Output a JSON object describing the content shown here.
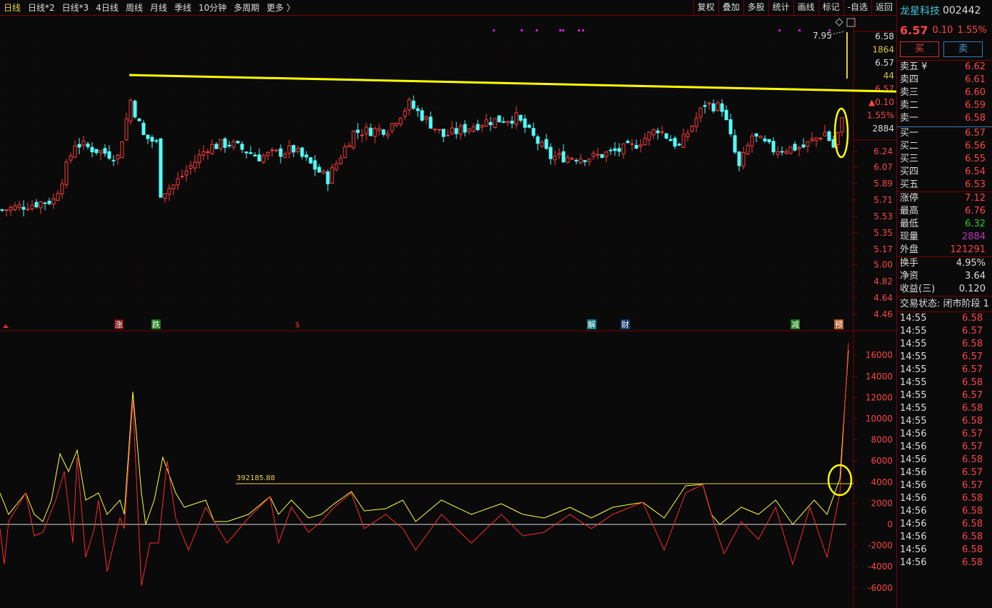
{
  "toolbar": {
    "periods": [
      "日线",
      "日线*2",
      "日线*3",
      "4日线",
      "周线",
      "月线",
      "季线",
      "10分钟",
      "多周期",
      "更多 〉"
    ],
    "tools": [
      "复权",
      "叠加",
      "多股",
      "统计",
      "画线",
      "标记",
      "-自选",
      "返回"
    ]
  },
  "stock": {
    "name": "龙星科技",
    "code": "002442",
    "price": "6.57",
    "change": "0.10",
    "change_pct": "1.55%",
    "buy_label": "买",
    "sell_label": "卖"
  },
  "order_book": {
    "asks": [
      {
        "label": "卖五 ¥",
        "price": "6.62"
      },
      {
        "label": "卖四",
        "price": "6.61"
      },
      {
        "label": "卖三",
        "price": "6.60"
      },
      {
        "label": "卖二",
        "price": "6.59"
      },
      {
        "label": "卖一",
        "price": "6.58"
      }
    ],
    "bids": [
      {
        "label": "买一",
        "price": "6.57"
      },
      {
        "label": "买二",
        "price": "6.56"
      },
      {
        "label": "买三",
        "price": "6.55"
      },
      {
        "label": "买四",
        "price": "6.54"
      },
      {
        "label": "买五",
        "price": "6.53"
      }
    ]
  },
  "stats": [
    {
      "label": "涨停",
      "value": "7.12",
      "color": "red"
    },
    {
      "label": "最高",
      "value": "6.76",
      "color": "red"
    },
    {
      "label": "最低",
      "value": "6.32",
      "color": "green"
    },
    {
      "label": "现量",
      "value": "2884",
      "color": "purple"
    },
    {
      "label": "外盘",
      "value": "121291",
      "color": "red"
    }
  ],
  "stats2": [
    {
      "label": "换手",
      "value": "4.95%"
    },
    {
      "label": "净资",
      "value": "3.64"
    },
    {
      "label": "收益(三)",
      "value": "0.120"
    }
  ],
  "trade_status": "交易状态: 闭市阶段 1",
  "trades": [
    [
      "14:55",
      "6.58"
    ],
    [
      "14:55",
      "6.57"
    ],
    [
      "14:55",
      "6.58"
    ],
    [
      "14:55",
      "6.57"
    ],
    [
      "14:55",
      "6.57"
    ],
    [
      "14:55",
      "6.58"
    ],
    [
      "14:55",
      "6.57"
    ],
    [
      "14:55",
      "6.58"
    ],
    [
      "14:55",
      "6.58"
    ],
    [
      "14:56",
      "6.57"
    ],
    [
      "14:56",
      "6.57"
    ],
    [
      "14:56",
      "6.58"
    ],
    [
      "14:56",
      "6.57"
    ],
    [
      "14:56",
      "6.57"
    ],
    [
      "14:56",
      "6.58"
    ],
    [
      "14:56",
      "6.58"
    ],
    [
      "14:56",
      "6.58"
    ],
    [
      "14:56",
      "6.58"
    ],
    [
      "14:56",
      "6.58"
    ],
    [
      "14:56",
      "6.58"
    ]
  ],
  "price_axis": {
    "floating": [
      {
        "t": "6.58",
        "c": "#ddd"
      },
      {
        "t": "1864",
        "c": "#d8c840"
      },
      {
        "t": "6.57",
        "c": "#ddd"
      },
      {
        "t": "44",
        "c": "#d8c840"
      },
      {
        "t": "6.57",
        "c": "#ff4444"
      },
      {
        "t": "▲0.10",
        "c": "#ff4444"
      },
      {
        "t": "1.55%",
        "c": "#ff4444"
      },
      {
        "t": "2884",
        "c": "#ddd"
      }
    ],
    "ticks": [
      "6.24",
      "6.07",
      "5.89",
      "5.71",
      "5.53",
      "5.35",
      "5.17",
      "5.00",
      "4.82",
      "4.64",
      "4.46"
    ]
  },
  "annotation_high": "7.95",
  "event_markers": [
    {
      "t": "涨",
      "bg": "#7a1010"
    },
    {
      "t": "跌",
      "bg": "#1a7a1a"
    },
    {
      "t": "$",
      "bg": "transparent"
    },
    {
      "t": "解",
      "bg": "#137a80"
    },
    {
      "t": "财",
      "bg": "#123a6a"
    },
    {
      "t": "减",
      "bg": "#1a7a1a"
    },
    {
      "t": "预",
      "bg": "#b05a20"
    }
  ],
  "chart_data": [
    {
      "type": "candlestick",
      "title": "日线",
      "price_keypoints": [
        [
          0,
          5.6
        ],
        [
          12,
          5.71
        ],
        [
          14,
          5.94
        ],
        [
          17,
          6.33
        ],
        [
          27,
          6.18
        ],
        [
          30,
          6.8
        ],
        [
          33,
          6.41
        ],
        [
          36,
          6.33
        ],
        [
          37,
          5.79
        ],
        [
          40,
          5.87
        ],
        [
          48,
          6.29
        ],
        [
          53,
          6.33
        ],
        [
          60,
          6.18
        ],
        [
          68,
          6.26
        ],
        [
          76,
          5.94
        ],
        [
          82,
          6.45
        ],
        [
          90,
          6.49
        ],
        [
          95,
          6.76
        ],
        [
          103,
          6.41
        ],
        [
          113,
          6.57
        ],
        [
          120,
          6.61
        ],
        [
          128,
          6.18
        ],
        [
          138,
          6.18
        ],
        [
          147,
          6.29
        ],
        [
          153,
          6.49
        ],
        [
          158,
          6.29
        ],
        [
          164,
          6.76
        ],
        [
          168,
          6.72
        ],
        [
          172,
          6.06
        ],
        [
          175,
          6.41
        ],
        [
          180,
          6.26
        ],
        [
          187,
          6.29
        ],
        [
          192,
          6.45
        ],
        [
          194,
          6.29
        ],
        [
          196,
          6.57
        ]
      ],
      "resistance_line_label": "trendline",
      "colors": {
        "up": "#ff3c3c",
        "down": "#54ffff",
        "trend": "#ffff00"
      }
    },
    {
      "type": "line",
      "title": "indicator",
      "reference_value": "392185.88",
      "reference_level": 3850,
      "ylim": [
        -6000,
        17000
      ],
      "yticks": [
        "16000",
        "14000",
        "12000",
        "10000",
        "8000",
        "6000",
        "4000",
        "2000",
        "0",
        "-2000",
        "-4000",
        "-6000"
      ],
      "series": [
        {
          "name": "yellow",
          "color": "#ffff40",
          "points": [
            [
              0,
              2970
            ],
            [
              2,
              950
            ],
            [
              6,
              2970
            ],
            [
              8,
              950
            ],
            [
              10,
              270
            ],
            [
              12,
              2300
            ],
            [
              14,
              6680
            ],
            [
              16,
              5000
            ],
            [
              18,
              7020
            ],
            [
              20,
              2300
            ],
            [
              23,
              2970
            ],
            [
              25,
              950
            ],
            [
              28,
              2300
            ],
            [
              29,
              950
            ],
            [
              31,
              12550
            ],
            [
              33,
              2970
            ],
            [
              34,
              0
            ],
            [
              36,
              2300
            ],
            [
              38,
              6350
            ],
            [
              41,
              2970
            ],
            [
              43,
              1620
            ],
            [
              48,
              2300
            ],
            [
              50,
              270
            ],
            [
              53,
              270
            ],
            [
              58,
              950
            ],
            [
              63,
              2630
            ],
            [
              65,
              950
            ],
            [
              68,
              2300
            ],
            [
              72,
              610
            ],
            [
              75,
              950
            ],
            [
              78,
              1960
            ],
            [
              82,
              3100
            ],
            [
              85,
              1280
            ],
            [
              90,
              1490
            ],
            [
              94,
              2300
            ],
            [
              97,
              270
            ],
            [
              103,
              2300
            ],
            [
              110,
              950
            ],
            [
              117,
              1960
            ],
            [
              122,
              950
            ],
            [
              127,
              610
            ],
            [
              133,
              1620
            ],
            [
              138,
              610
            ],
            [
              143,
              1620
            ],
            [
              150,
              2090
            ],
            [
              155,
              610
            ],
            [
              160,
              3650
            ],
            [
              164,
              3780
            ],
            [
              166,
              950
            ],
            [
              168,
              0
            ],
            [
              173,
              1620
            ],
            [
              177,
              950
            ],
            [
              181,
              2300
            ],
            [
              185,
              0
            ],
            [
              190,
              2300
            ],
            [
              193,
              950
            ],
            [
              196,
              4320
            ],
            [
              198,
              16470
            ]
          ]
        },
        {
          "name": "red",
          "color": "#ff2a2a",
          "points": [
            [
              0,
              -400
            ],
            [
              1,
              -3780
            ],
            [
              2,
              270
            ],
            [
              6,
              2970
            ],
            [
              8,
              -1080
            ],
            [
              10,
              -740
            ],
            [
              13,
              2300
            ],
            [
              15,
              5000
            ],
            [
              17,
              -1760
            ],
            [
              18,
              6350
            ],
            [
              20,
              -3100
            ],
            [
              22,
              -400
            ],
            [
              23,
              2300
            ],
            [
              25,
              -4450
            ],
            [
              28,
              610
            ],
            [
              29,
              -400
            ],
            [
              31,
              11750
            ],
            [
              33,
              -5800
            ],
            [
              35,
              -1760
            ],
            [
              37,
              -1760
            ],
            [
              39,
              6000
            ],
            [
              41,
              610
            ],
            [
              44,
              -2430
            ],
            [
              48,
              1620
            ],
            [
              51,
              -400
            ],
            [
              53,
              -1760
            ],
            [
              58,
              610
            ],
            [
              63,
              2630
            ],
            [
              65,
              -1760
            ],
            [
              68,
              1620
            ],
            [
              72,
              -740
            ],
            [
              75,
              270
            ],
            [
              78,
              1620
            ],
            [
              82,
              2970
            ],
            [
              85,
              -400
            ],
            [
              90,
              950
            ],
            [
              94,
              -400
            ],
            [
              97,
              -2430
            ],
            [
              103,
              950
            ],
            [
              110,
              -1760
            ],
            [
              117,
              950
            ],
            [
              122,
              -1080
            ],
            [
              127,
              -740
            ],
            [
              133,
              950
            ],
            [
              138,
              -400
            ],
            [
              143,
              950
            ],
            [
              150,
              2090
            ],
            [
              155,
              -2430
            ],
            [
              160,
              2970
            ],
            [
              164,
              3780
            ],
            [
              167,
              -400
            ],
            [
              169,
              -2770
            ],
            [
              173,
              270
            ],
            [
              177,
              -1420
            ],
            [
              181,
              1620
            ],
            [
              185,
              -3780
            ],
            [
              189,
              1620
            ],
            [
              193,
              -3100
            ],
            [
              196,
              2970
            ],
            [
              198,
              17150
            ]
          ]
        }
      ]
    }
  ]
}
